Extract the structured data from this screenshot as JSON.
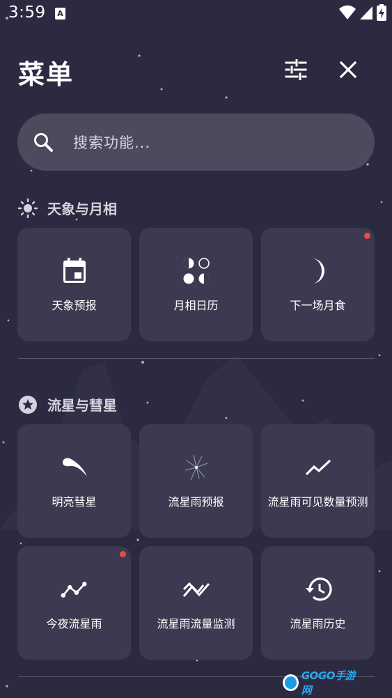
{
  "status_bar": {
    "time": "3:59",
    "notification_letter": "A"
  },
  "header": {
    "title": "菜单"
  },
  "search": {
    "placeholder": "搜索功能..."
  },
  "sections": [
    {
      "title": "天象与月相",
      "icon": "sun-icon",
      "cards": [
        {
          "label": "天象预报",
          "icon": "calendar-icon",
          "badge": false
        },
        {
          "label": "月相日历",
          "icon": "moon-phases-icon",
          "badge": false
        },
        {
          "label": "下一场月食",
          "icon": "crescent-moon-icon",
          "badge": true
        }
      ]
    },
    {
      "title": "流星与彗星",
      "icon": "star-circle-icon",
      "cards": [
        {
          "label": "明亮彗星",
          "icon": "comet-icon",
          "badge": false
        },
        {
          "label": "流星雨预报",
          "icon": "meteor-shower-icon",
          "badge": false
        },
        {
          "label": "流星雨可见数量预测",
          "icon": "trend-line-icon",
          "badge": false
        },
        {
          "label": "今夜流星雨",
          "icon": "wave-line-icon",
          "badge": true
        },
        {
          "label": "流星雨流量监测",
          "icon": "zigzag-chart-icon",
          "badge": false
        },
        {
          "label": "流星雨历史",
          "icon": "history-icon",
          "badge": false
        }
      ]
    }
  ],
  "watermark": {
    "text": "GOGO手游网"
  },
  "colors": {
    "background": "#2b2a40",
    "card": "#3b3a50",
    "search": "#4c4b5e",
    "badge": "#ec4848",
    "section_title": "#d4d3dd"
  }
}
